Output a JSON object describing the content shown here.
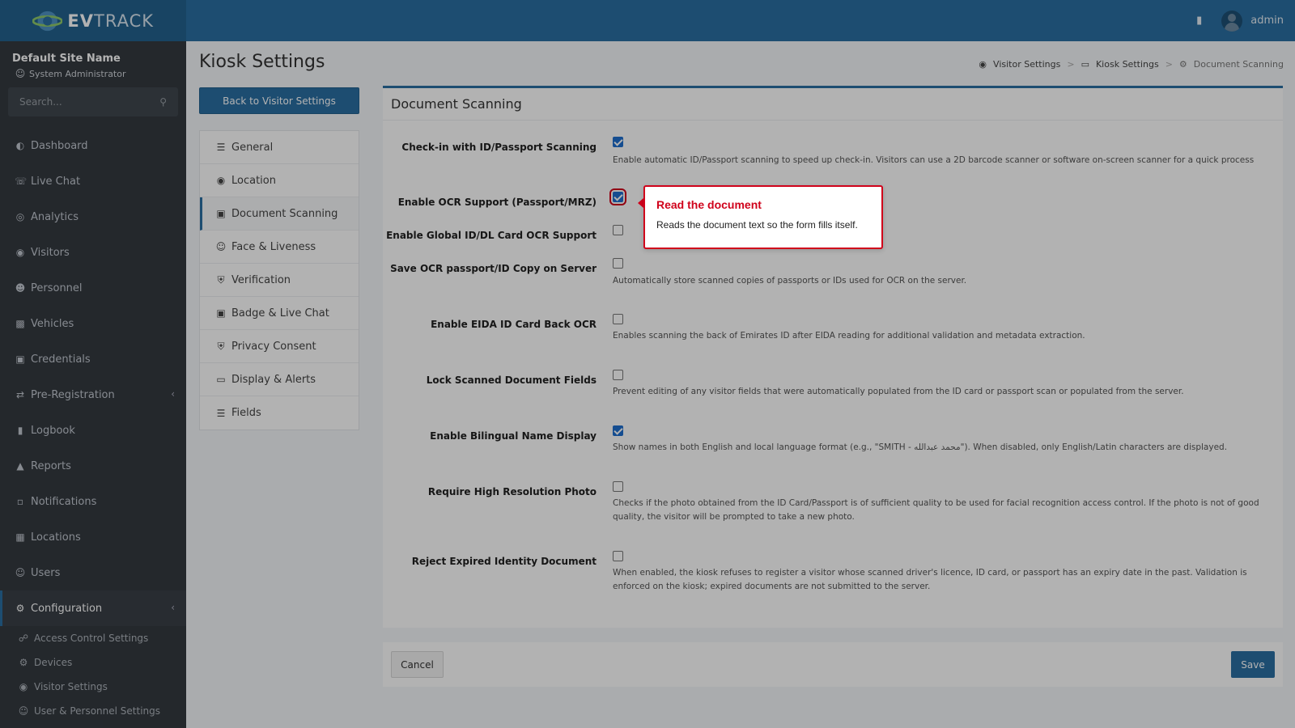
{
  "app": {
    "brand_prefix": "EV",
    "brand_suffix": "TRACK",
    "user": "admin"
  },
  "sidebar": {
    "site_name": "Default Site Name",
    "site_role": "System Administrator",
    "search_placeholder": "Search...",
    "items": [
      {
        "label": "Dashboard"
      },
      {
        "label": "Live Chat"
      },
      {
        "label": "Analytics"
      },
      {
        "label": "Visitors"
      },
      {
        "label": "Personnel"
      },
      {
        "label": "Vehicles"
      },
      {
        "label": "Credentials"
      },
      {
        "label": "Pre-Registration"
      },
      {
        "label": "Logbook"
      },
      {
        "label": "Reports"
      },
      {
        "label": "Notifications"
      },
      {
        "label": "Locations"
      },
      {
        "label": "Users"
      },
      {
        "label": "Configuration"
      }
    ],
    "sub_items": [
      {
        "label": "Access Control Settings"
      },
      {
        "label": "Devices"
      },
      {
        "label": "Visitor Settings"
      },
      {
        "label": "User & Personnel Settings"
      }
    ]
  },
  "page": {
    "title": "Kiosk Settings",
    "back_button": "Back to Visitor Settings",
    "breadcrumb": [
      "Visitor Settings",
      "Kiosk Settings",
      "Document Scanning"
    ]
  },
  "subnav": [
    {
      "label": "General"
    },
    {
      "label": "Location"
    },
    {
      "label": "Document Scanning"
    },
    {
      "label": "Face & Liveness"
    },
    {
      "label": "Verification"
    },
    {
      "label": "Badge & Live Chat"
    },
    {
      "label": "Privacy Consent"
    },
    {
      "label": "Display & Alerts"
    },
    {
      "label": "Fields"
    }
  ],
  "card": {
    "title": "Document Scanning",
    "settings": [
      {
        "label": "Check-in with ID/Passport Scanning",
        "checked": true,
        "help": "Enable automatic ID/Passport scanning to speed up check-in. Visitors can use a 2D barcode scanner or software on-screen scanner for a quick process"
      },
      {
        "label": "Enable OCR Support (Passport/MRZ)",
        "checked": true,
        "help": ""
      },
      {
        "label": "Enable Global ID/DL Card OCR Support",
        "checked": false,
        "help": ""
      },
      {
        "label": "Save OCR passport/ID Copy on Server",
        "checked": false,
        "help": "Automatically store scanned copies of passports or IDs used for OCR on the server."
      },
      {
        "label": "Enable EIDA ID Card Back OCR",
        "checked": false,
        "help": "Enables scanning the back of Emirates ID after EIDA reading for additional validation and metadata extraction."
      },
      {
        "label": "Lock Scanned Document Fields",
        "checked": false,
        "help": "Prevent editing of any visitor fields that were automatically populated from the ID card or passport scan or populated from the server."
      },
      {
        "label": "Enable Bilingual Name Display",
        "checked": true,
        "help": "Show names in both English and local language format (e.g., \"SMITH - محمد عبدالله\"). When disabled, only English/Latin characters are displayed."
      },
      {
        "label": "Require High Resolution Photo",
        "checked": false,
        "help": "Checks if the photo obtained from the ID Card/Passport is of sufficient quality to be used for facial recognition access control. If the photo is not of good quality, the visitor will be prompted to take a new photo."
      },
      {
        "label": "Reject Expired Identity Document",
        "checked": false,
        "help": "When enabled, the kiosk refuses to register a visitor whose scanned driver's licence, ID card, or passport has an expiry date in the past. Validation is enforced on the kiosk; expired documents are not submitted to the server."
      }
    ]
  },
  "tooltip": {
    "title": "Read the document",
    "text": "Reads the document text so the form fills itself."
  },
  "footer": {
    "cancel": "Cancel",
    "save": "Save"
  }
}
